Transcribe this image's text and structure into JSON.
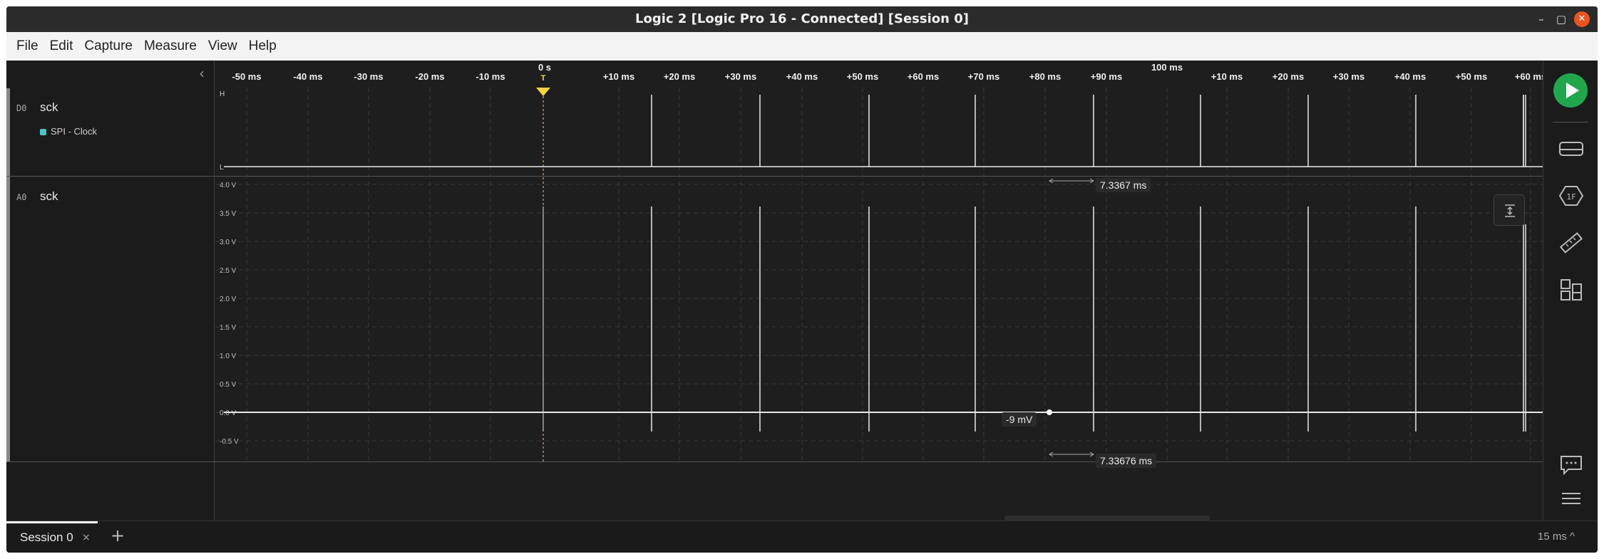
{
  "window": {
    "title": "Logic 2 [Logic Pro 16 - Connected] [Session 0]"
  },
  "menubar": [
    "File",
    "Edit",
    "Capture",
    "Measure",
    "View",
    "Help"
  ],
  "timeline": {
    "ticks": [
      "-50 ms",
      "-40 ms",
      "-30 ms",
      "-20 ms",
      "-10 ms",
      "+10 ms",
      "+20 ms",
      "+30 ms",
      "+40 ms",
      "+50 ms",
      "+60 ms",
      "+70 ms",
      "+80 ms",
      "+90 ms",
      "+10 ms",
      "+20 ms",
      "+30 ms",
      "+40 ms",
      "+50 ms",
      "+60 ms"
    ],
    "zero_label": "0 s",
    "hundred_label": "100 ms",
    "trigger_label": "T"
  },
  "channels": [
    {
      "tag": "D0",
      "name": "sck",
      "analyzer": "SPI - Clock",
      "level_high": "H",
      "level_low": "L"
    },
    {
      "tag": "A0",
      "name": "sck"
    }
  ],
  "analog_axis": [
    "4.0 V",
    "3.5 V",
    "3.0 V",
    "2.5 V",
    "2.0 V",
    "1.5 V",
    "1.0 V",
    "0.5 V",
    "0.0 V",
    "-0.5 V"
  ],
  "measurements": {
    "digital_period": "7.3367 ms",
    "analog_period": "7.33676 ms",
    "cursor_value": "-9 mV"
  },
  "bottom": {
    "session_tab": "Session 0",
    "session_close": "×",
    "add_session": "+",
    "time_scale": "15 ms ^"
  },
  "colors": {
    "accent_play": "#21a64e",
    "trigger": "#f5d442",
    "analyzer_dot": "#4fc3c3"
  }
}
